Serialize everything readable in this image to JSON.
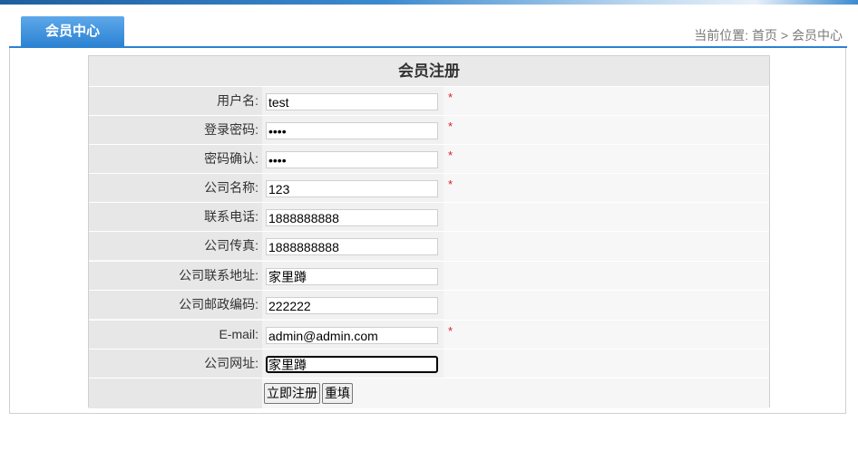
{
  "header": {
    "tab_label": "会员中心",
    "breadcrumb": "当前位置: 首页 > 会员中心"
  },
  "form": {
    "title": "会员注册",
    "fields": [
      {
        "label": "用户名:",
        "value": "test",
        "required": "*"
      },
      {
        "label": "登录密码:",
        "value": "••••",
        "required": "*"
      },
      {
        "label": "密码确认:",
        "value": "••••",
        "required": "*"
      },
      {
        "label": "公司名称:",
        "value": "123",
        "required": "*"
      },
      {
        "label": "联系电话:",
        "value": "1888888888",
        "required": ""
      },
      {
        "label": "公司传真:",
        "value": "1888888888",
        "required": ""
      },
      {
        "label": "公司联系地址:",
        "value": "家里蹲",
        "required": ""
      },
      {
        "label": "公司邮政编码:",
        "value": "222222",
        "required": ""
      },
      {
        "label": "E-mail:",
        "value": "admin@admin.com",
        "required": "*"
      },
      {
        "label": "公司网址:",
        "value": "家里蹲",
        "required": ""
      }
    ],
    "submit_label": "立即注册",
    "reset_label": "重填"
  },
  "colors": {
    "accent": "#2b82d2",
    "required": "#e02020"
  }
}
